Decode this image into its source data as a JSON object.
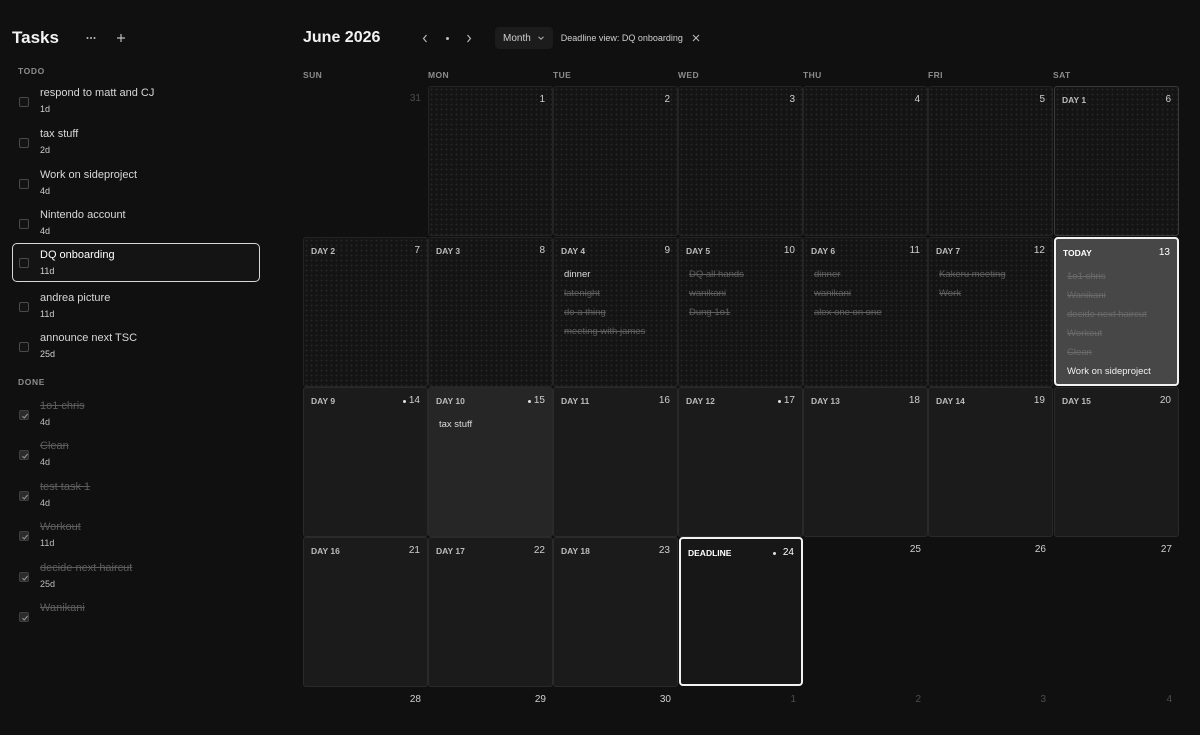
{
  "sidebar": {
    "title": "Tasks",
    "todo_label": "TODO",
    "done_label": "DONE",
    "todo": [
      {
        "title": "respond to matt and CJ",
        "age": "1d"
      },
      {
        "title": "tax stuff",
        "age": "2d"
      },
      {
        "title": "Work on sideproject",
        "age": "4d"
      },
      {
        "title": "Nintendo account",
        "age": "4d"
      },
      {
        "title": "DQ onboarding",
        "age": "11d"
      },
      {
        "title": "andrea picture",
        "age": "11d"
      },
      {
        "title": "announce next TSC",
        "age": "25d"
      }
    ],
    "done": [
      {
        "title": "1o1 chris",
        "age": "4d"
      },
      {
        "title": "Clean",
        "age": "4d"
      },
      {
        "title": "test task 1",
        "age": "4d"
      },
      {
        "title": "Workout",
        "age": "11d"
      },
      {
        "title": "decide next haircut",
        "age": "25d"
      },
      {
        "title": "Wanikani",
        "age": ""
      }
    ]
  },
  "toolbar": {
    "month_title": "June 2026",
    "view": "Month",
    "deadline_view": "Deadline view: DQ onboarding"
  },
  "calendar": {
    "weekdays": [
      "SUN",
      "MON",
      "TUE",
      "WED",
      "THU",
      "FRI",
      "SAT"
    ],
    "weeks": [
      [
        {
          "date": "31",
          "label": ""
        },
        {
          "date": "1",
          "label": ""
        },
        {
          "date": "2",
          "label": ""
        },
        {
          "date": "3",
          "label": ""
        },
        {
          "date": "4",
          "label": ""
        },
        {
          "date": "5",
          "label": ""
        },
        {
          "date": "6",
          "label": "DAY 1"
        }
      ],
      [
        {
          "date": "7",
          "label": "DAY 2"
        },
        {
          "date": "8",
          "label": "DAY 3"
        },
        {
          "date": "9",
          "label": "DAY 4",
          "events": [
            "dinner",
            "latenight",
            "do a thing",
            "meeting with james"
          ]
        },
        {
          "date": "10",
          "label": "DAY 5",
          "events": [
            "DQ all hands",
            "wanikani",
            "Dung 1o1"
          ]
        },
        {
          "date": "11",
          "label": "DAY 6",
          "events": [
            "dinner",
            "wanikani",
            "alex one on one"
          ]
        },
        {
          "date": "12",
          "label": "DAY 7",
          "events": [
            "Kakeru meeting",
            "Work"
          ]
        },
        {
          "date": "13",
          "label": "TODAY",
          "events": [
            "1o1 chris",
            "Wanikani",
            "decide next haircut",
            "Workout",
            "Clean",
            "Work on sideproject"
          ]
        }
      ],
      [
        {
          "date": "14",
          "label": "DAY 9"
        },
        {
          "date": "15",
          "label": "DAY 10",
          "events": [
            "tax stuff"
          ]
        },
        {
          "date": "16",
          "label": "DAY 11"
        },
        {
          "date": "17",
          "label": "DAY 12"
        },
        {
          "date": "18",
          "label": "DAY 13"
        },
        {
          "date": "19",
          "label": "DAY 14"
        },
        {
          "date": "20",
          "label": "DAY 15"
        }
      ],
      [
        {
          "date": "21",
          "label": "DAY 16"
        },
        {
          "date": "22",
          "label": "DAY 17"
        },
        {
          "date": "23",
          "label": "DAY 18"
        },
        {
          "date": "24",
          "label": "DEADLINE"
        },
        {
          "date": "25",
          "label": ""
        },
        {
          "date": "26",
          "label": ""
        },
        {
          "date": "27",
          "label": ""
        }
      ],
      [
        {
          "date": "28",
          "label": ""
        },
        {
          "date": "29",
          "label": ""
        },
        {
          "date": "30",
          "label": ""
        },
        {
          "date": "1",
          "label": ""
        },
        {
          "date": "2",
          "label": ""
        },
        {
          "date": "3",
          "label": ""
        },
        {
          "date": "4",
          "label": ""
        }
      ]
    ]
  },
  "colors": {
    "background": "#101010",
    "cell": "#1b1b1b",
    "today_cell": "#474747",
    "highlight_border": "#f2f2f2"
  }
}
